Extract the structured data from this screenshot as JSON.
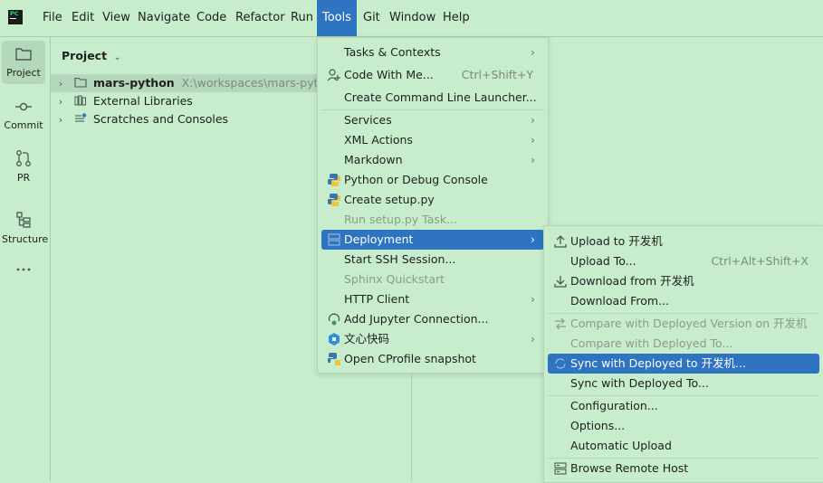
{
  "menubar": {
    "logo_text": "PC",
    "items": [
      "File",
      "Edit",
      "View",
      "Navigate",
      "Code",
      "Refactor",
      "Run",
      "Tools",
      "Git",
      "Window",
      "Help"
    ]
  },
  "toolwindows": [
    {
      "label": "Project"
    },
    {
      "label": "Commit"
    },
    {
      "label": "PR"
    },
    {
      "label": "Structure"
    }
  ],
  "project_panel": {
    "title": "Project",
    "tree": [
      {
        "label": "mars-python",
        "path": "X:\\workspaces\\mars-python"
      },
      {
        "label": "External Libraries"
      },
      {
        "label": "Scratches and Consoles"
      }
    ]
  },
  "tools_menu": {
    "items": [
      {
        "label": "Tasks & Contexts"
      },
      {
        "label": "Code With Me...",
        "shortcut": "Ctrl+Shift+Y"
      },
      {
        "label": "Create Command Line Launcher..."
      },
      {
        "label": "Services"
      },
      {
        "label": "XML Actions"
      },
      {
        "label": "Markdown"
      },
      {
        "label": "Python or Debug Console"
      },
      {
        "label": "Create setup.py"
      },
      {
        "label": "Run setup.py Task..."
      },
      {
        "label": "Deployment"
      },
      {
        "label": "Start SSH Session..."
      },
      {
        "label": "Sphinx Quickstart"
      },
      {
        "label": "HTTP Client"
      },
      {
        "label": "Add Jupyter Connection..."
      },
      {
        "label": "文心快码"
      },
      {
        "label": "Open CProfile snapshot"
      }
    ]
  },
  "deployment_menu": {
    "items": [
      {
        "label": "Upload to 开发机"
      },
      {
        "label": "Upload To...",
        "shortcut": "Ctrl+Alt+Shift+X"
      },
      {
        "label": "Download from 开发机"
      },
      {
        "label": "Download From..."
      },
      {
        "label": "Compare with Deployed Version on 开发机"
      },
      {
        "label": "Compare with Deployed To..."
      },
      {
        "label": "Sync with Deployed to 开发机..."
      },
      {
        "label": "Sync with Deployed To..."
      },
      {
        "label": "Configuration..."
      },
      {
        "label": "Options..."
      },
      {
        "label": "Automatic Upload"
      },
      {
        "label": "Browse Remote Host"
      }
    ]
  },
  "colors": {
    "background": "#c7edcc",
    "accent": "#2e74c0",
    "disabled_text": "#8c9a8f"
  }
}
